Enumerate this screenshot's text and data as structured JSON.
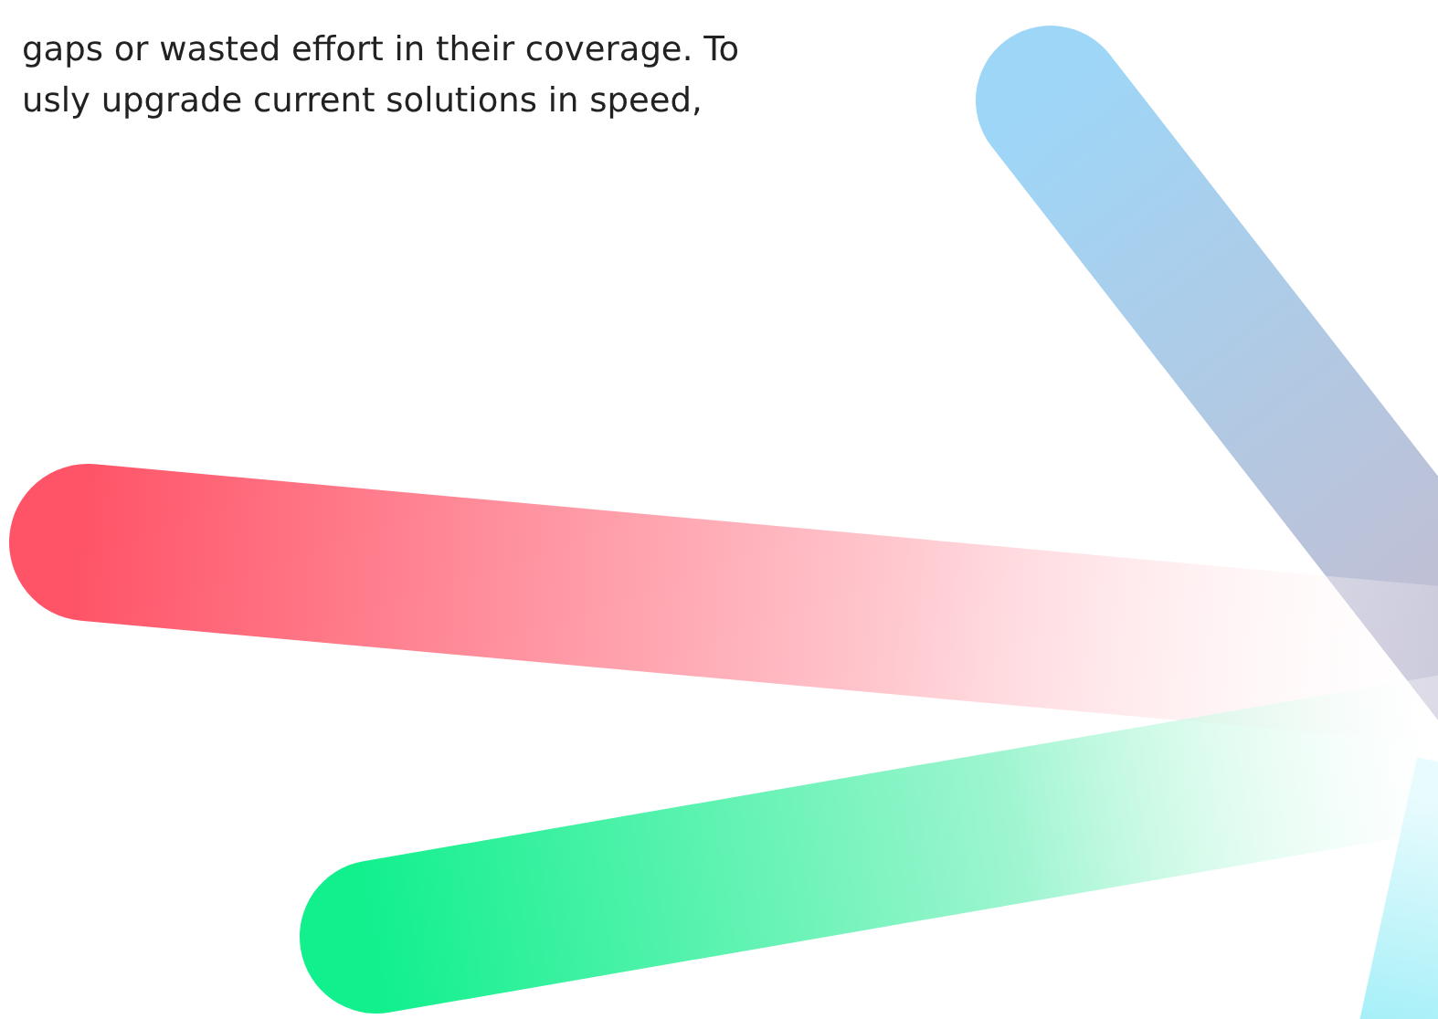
{
  "paragraph": {
    "lines": [
      "gaps or wasted effort in their coverage. To",
      "usly upgrade current solutions in speed,"
    ]
  }
}
